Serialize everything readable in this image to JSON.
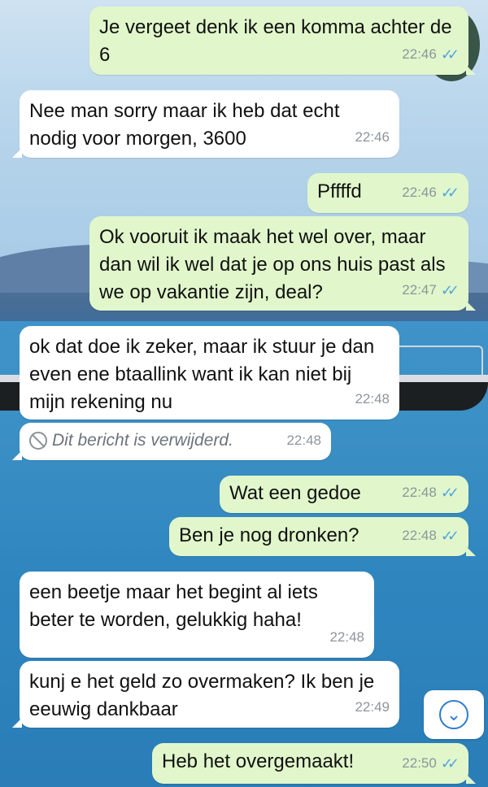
{
  "messages": [
    {
      "side": "out",
      "text": "Je vergeet denk ik een komma achter de 6",
      "time": "22:46",
      "ticks": "✓✓"
    },
    {
      "side": "in",
      "text": "Nee man sorry maar ik heb dat echt nodig voor morgen, 3600",
      "time": "22:46"
    },
    {
      "side": "out",
      "text": "Pffffd",
      "time": "22:46",
      "ticks": "✓✓"
    },
    {
      "side": "out",
      "text": "Ok vooruit ik maak het wel over, maar dan wil ik wel dat je op ons huis past als we op vakantie zijn, deal?",
      "time": "22:47",
      "ticks": "✓✓"
    },
    {
      "side": "in",
      "text": "ok dat doe ik zeker, maar ik stuur je dan even ene btaallink want ik kan niet bij mijn rekening nu",
      "time": "22:48"
    },
    {
      "side": "in",
      "deleted": true,
      "text": "Dit bericht is verwijderd.",
      "time": "22:48"
    },
    {
      "side": "out",
      "text": "Wat een gedoe",
      "time": "22:48",
      "ticks": "✓✓"
    },
    {
      "side": "out",
      "text": "Ben je nog dronken?",
      "time": "22:48",
      "ticks": "✓✓"
    },
    {
      "side": "in",
      "text": "een beetje maar het begint al iets beter te worden, gelukkig haha!",
      "time": "22:48"
    },
    {
      "side": "in",
      "text": "kunj e het geld zo overmaken? Ik ben je eeuwig dankbaar",
      "time": "22:49"
    },
    {
      "side": "out",
      "text": "Heb het overgemaakt!",
      "time": "22:50",
      "ticks": "✓✓"
    }
  ],
  "icons": {
    "deleted": "ban-icon",
    "scroll_down": "chevron-down-circle-icon"
  },
  "colors": {
    "outgoing_bubble": "#e1f7cb",
    "incoming_bubble": "#ffffff",
    "read_ticks": "#4fa5e0"
  }
}
